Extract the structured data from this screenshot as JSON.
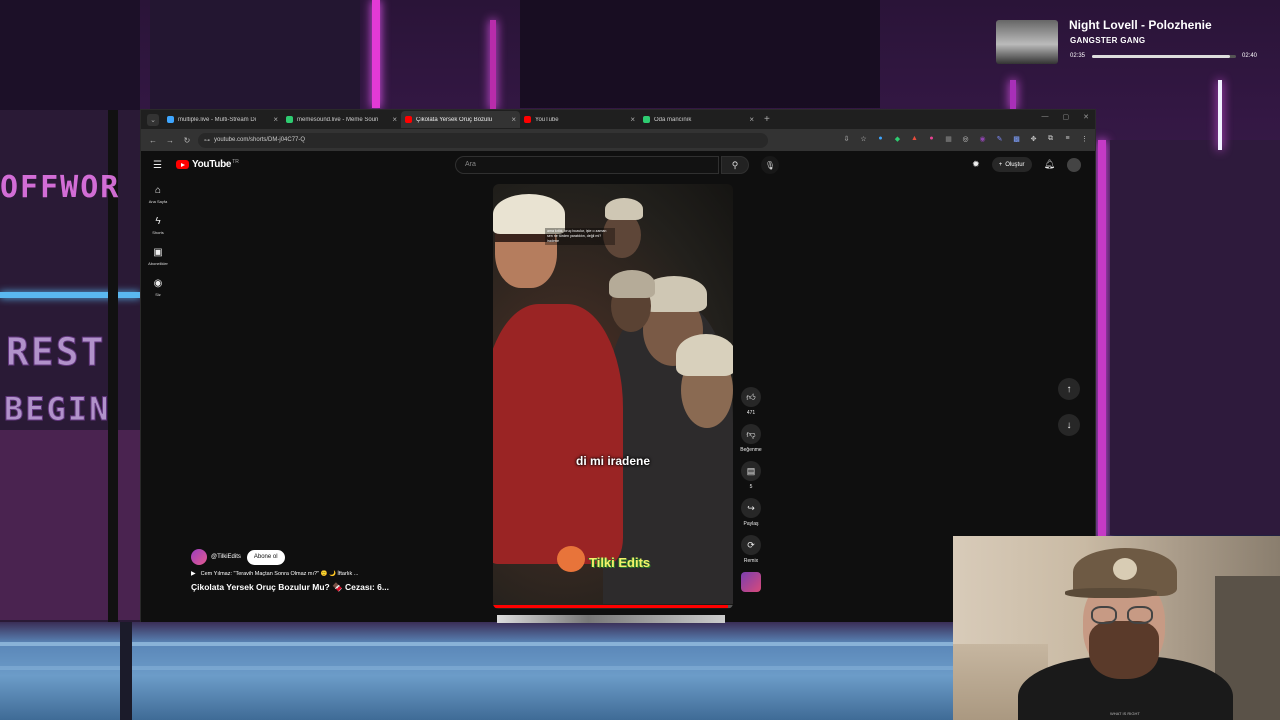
{
  "now_playing": {
    "title": "Night Lovell - Polozhenie",
    "artist": "GANGSTER GANG",
    "elapsed": "02:35",
    "duration": "02:40",
    "progress": 0.96
  },
  "background": {
    "sign_1": "OFFWOR",
    "sign_2": "REST",
    "sign_3": "BEGIN"
  },
  "browser": {
    "tabs": [
      {
        "label": "multiple.live - Multi-Stream Di",
        "favicon_color": "#3ea6ff"
      },
      {
        "label": "memesound.live - Meme Soun",
        "favicon_color": "#2ecc71"
      },
      {
        "label": "Çikolata Yersek Oruç Bozulu",
        "favicon_color": "#ff0000",
        "active": true
      },
      {
        "label": "YouTube",
        "favicon_color": "#ff0000"
      },
      {
        "label": "Oda mancınık",
        "favicon_color": "#2ecc71"
      }
    ],
    "url": "youtube.com/shorts/DM-j04C77-Q"
  },
  "youtube": {
    "logo": "YouTube",
    "region": "TR",
    "search_placeholder": "Ara",
    "create_label": "Oluştur",
    "sidebar": [
      {
        "icon": "home-icon",
        "label": "Ana Sayfa",
        "glyph": "⌂"
      },
      {
        "icon": "shorts-icon",
        "label": "Shorts",
        "glyph": "ϟ"
      },
      {
        "icon": "subscriptions-icon",
        "label": "Abonelikler",
        "glyph": "▣"
      },
      {
        "icon": "you-icon",
        "label": "Siz",
        "glyph": "◉"
      }
    ],
    "video": {
      "overlay_caption": "ama kıtlık, oruç bozulur, işte o zaman sen ne türden yaratıktın, değil mi? iradene",
      "subtitle": "di mi iradene",
      "watermark": "Tilki Edits",
      "progress": 0.98
    },
    "actions": {
      "like_count": "471",
      "dislike_label": "Beğenme",
      "comment_count": "5",
      "share_label": "Paylaş",
      "remix_label": "Remix"
    },
    "channel": {
      "handle": "@TilkiEdits",
      "subscribe_label": "Abone ol",
      "music": "Cem Yılmaz: \"Teravih Maçtan Sonra Olmaz mı?\" 🙂 🌙 İftarlık ...",
      "title": "Çikolata Yersek Oruç Bozulur Mu? 🍫 Cezası: 6..."
    }
  },
  "webcam": {
    "shirt_text": "WHAT IS RIGHT"
  }
}
